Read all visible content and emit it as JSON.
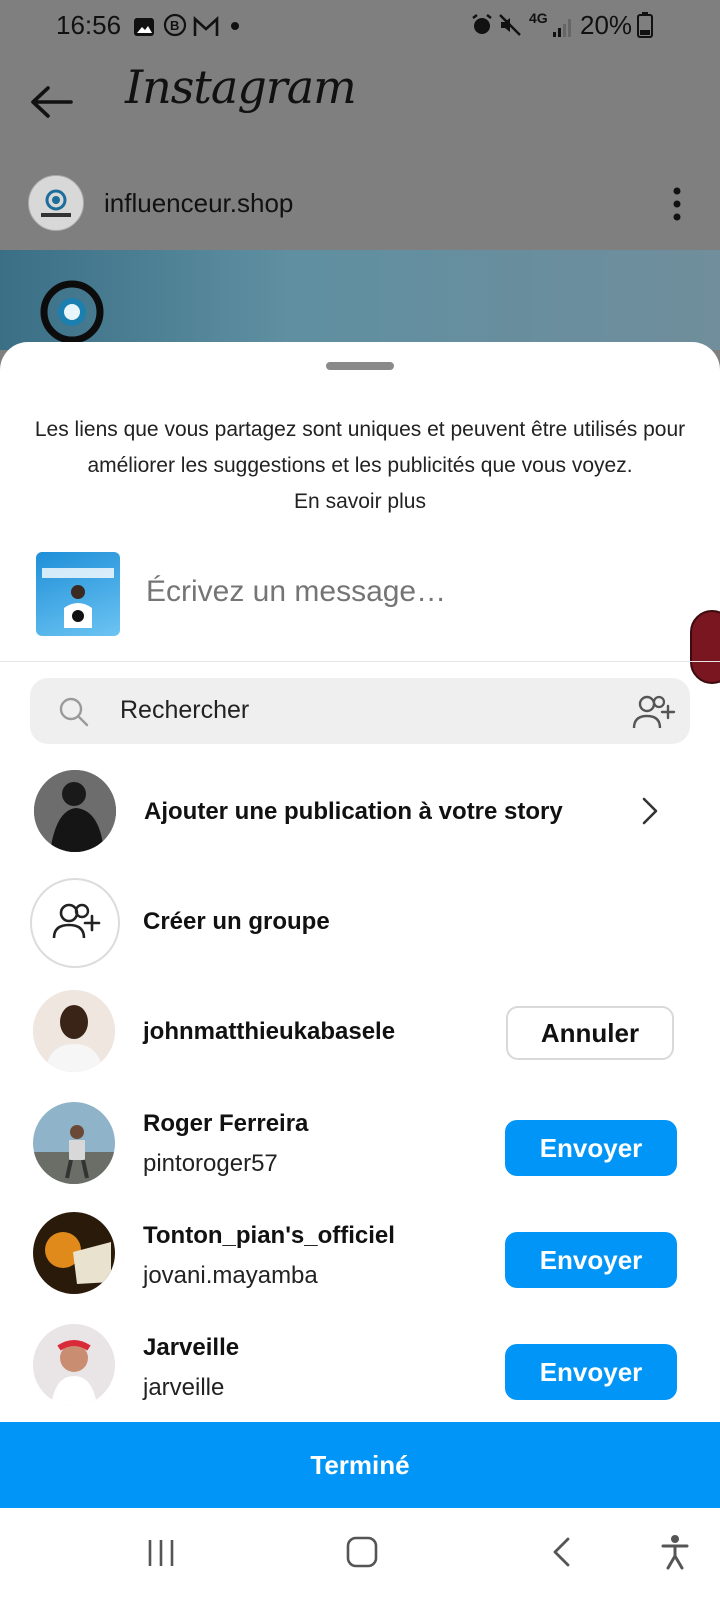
{
  "status_bar": {
    "time": "16:56",
    "battery": "20%",
    "network": "4G",
    "icons": [
      "image-icon",
      "b-icon",
      "mail-icon",
      "dot-icon",
      "alarm-icon",
      "mute-icon",
      "signal-icon",
      "battery-icon"
    ]
  },
  "app_bar": {
    "logo": "Instagram",
    "back_icon": "arrow-left-icon"
  },
  "post": {
    "username": "influenceur.shop",
    "menu_icon": "more-vertical-icon"
  },
  "share_sheet": {
    "notice": "Les liens que vous partagez sont uniques et peuvent être utilisés pour améliorer les suggestions et les publicités que vous voyez.",
    "learn_more": "En savoir plus",
    "message_placeholder": "Écrivez un message…",
    "search_placeholder": "Rechercher",
    "add_story_label": "Ajouter une publication à votre story",
    "create_group_label": "Créer un groupe",
    "contacts": [
      {
        "name": "johnmatthieukabasele",
        "username": "",
        "action": "Annuler"
      },
      {
        "name": "Roger Ferreira",
        "username": "pintoroger57",
        "action": "Envoyer"
      },
      {
        "name": "Tonton_pian's_officiel",
        "username": "jovani.mayamba",
        "action": "Envoyer"
      },
      {
        "name": "Jarveille",
        "username": "jarveille",
        "action": "Envoyer"
      }
    ],
    "done_label": "Terminé"
  },
  "colors": {
    "primary_blue": "#0095f6",
    "dim_overlay": "#7f7f7f",
    "sheet_bg": "#ffffff"
  }
}
